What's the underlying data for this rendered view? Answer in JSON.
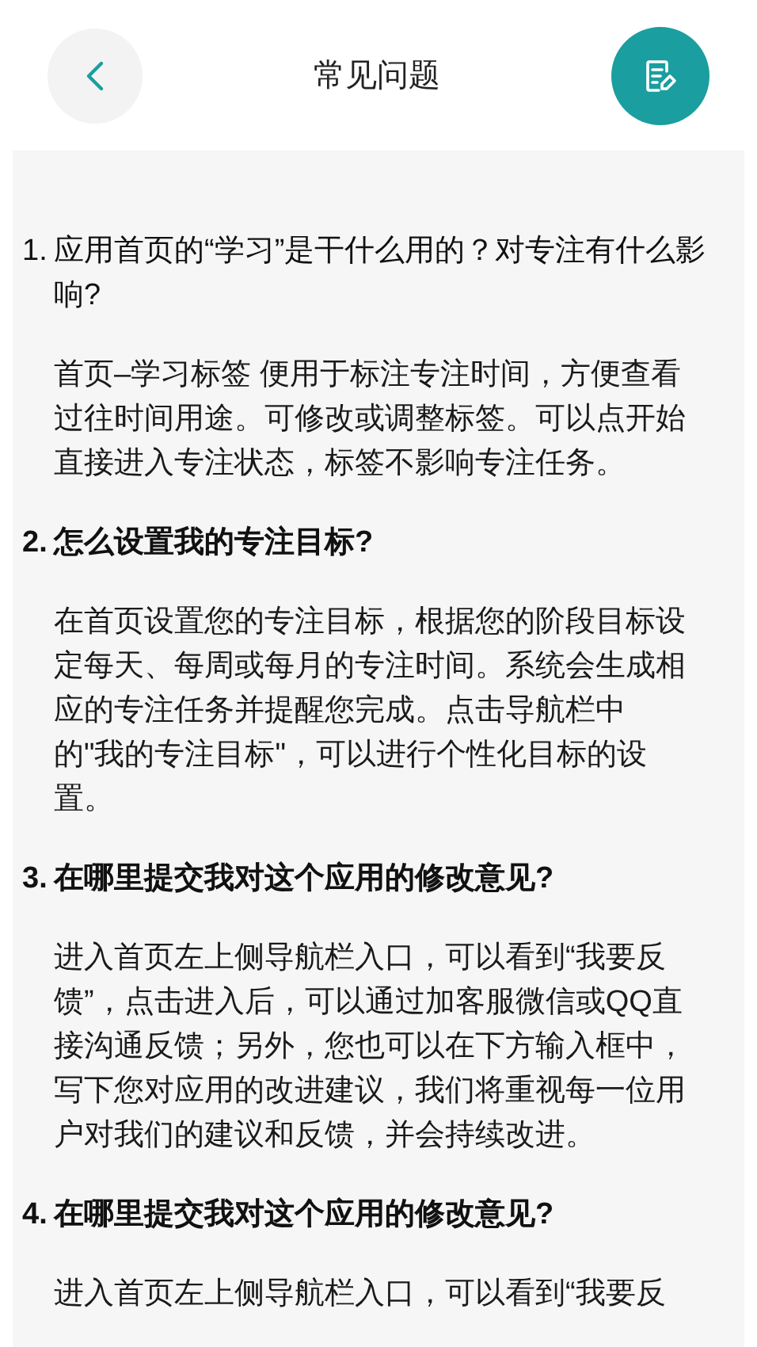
{
  "header": {
    "title": "常见问题"
  },
  "faq": [
    {
      "number": "1.",
      "question": "应用首页的“学习”是干什么用的？对专注有什么影响?",
      "answer": "首页–学习标签 便用于标注专注时间，方便查看过往时间用途。可修改或调整标签。可以点开始直接进入专注状态，标签不影响专注任务。",
      "bold": false
    },
    {
      "number": "2.",
      "question": "怎么设置我的专注目标?",
      "answer": "在首页设置您的专注目标，根据您的阶段目标设定每天、每周或每月的专注时间。系统会生成相应的专注任务并提醒您完成。点击导航栏中的\"我的专注目标\"，可以进行个性化目标的设置。",
      "bold": true
    },
    {
      "number": "3.",
      "question": "在哪里提交我对这个应用的修改意见?",
      "answer": "进入首页左上侧导航栏入口，可以看到“我要反馈”，点击进入后，可以通过加客服微信或QQ直接沟通反馈；另外，您也可以在下方输入框中，写下您对应用的改进建议，我们将重视每一位用户对我们的建议和反馈，并会持续改进。",
      "bold": true
    },
    {
      "number": "4.",
      "question": "在哪里提交我对这个应用的修改意见?",
      "answer": "进入首页左上侧导航栏入口，可以看到“我要反",
      "bold": true
    }
  ]
}
